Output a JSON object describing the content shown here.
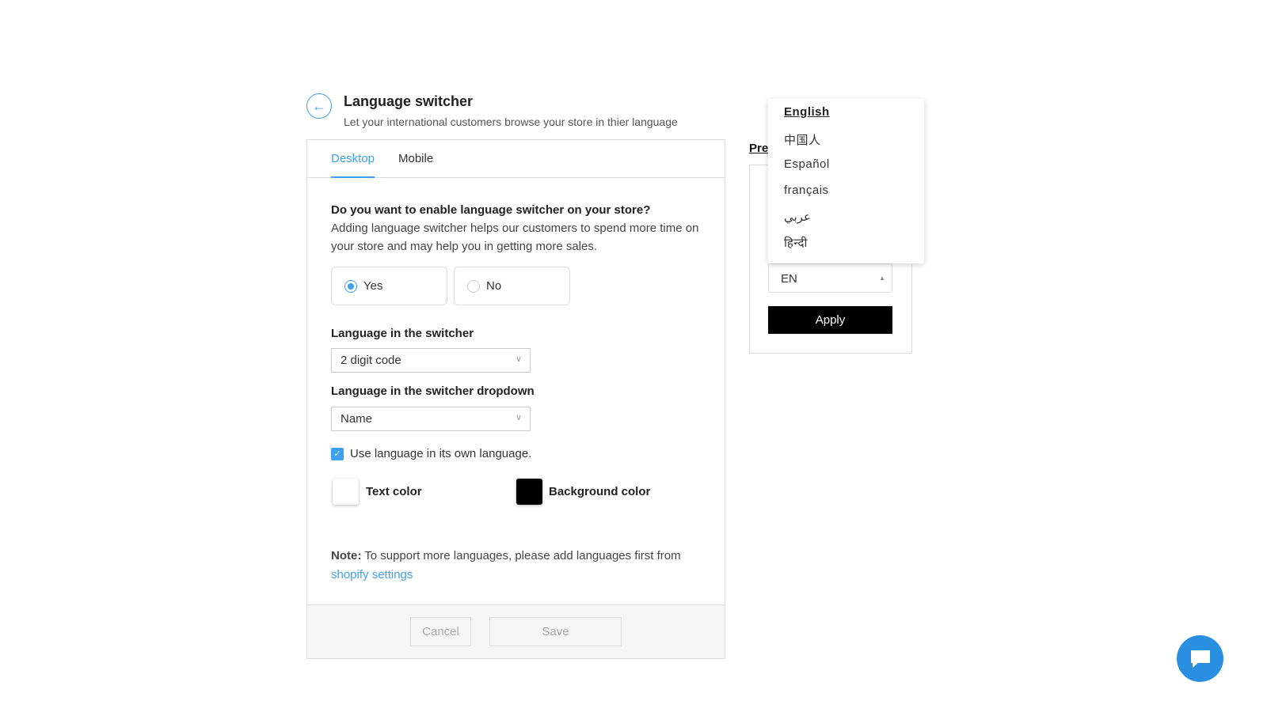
{
  "header": {
    "title": "Language switcher",
    "subtitle": "Let your international customers browse your store in thier language",
    "back_icon": "arrow-left-icon"
  },
  "tabs": [
    {
      "label": "Desktop",
      "active": true
    },
    {
      "label": "Mobile",
      "active": false
    }
  ],
  "enable": {
    "question": "Do you want to enable language switcher on your store?",
    "description": "Adding language switcher helps our customers to spend more time on your store and may help you in getting more sales.",
    "options": [
      {
        "label": "Yes",
        "selected": true
      },
      {
        "label": "No",
        "selected": false
      }
    ]
  },
  "switcher_language": {
    "label": "Language in the switcher",
    "value": "2 digit code"
  },
  "dropdown_language": {
    "label": "Language in the switcher dropdown",
    "value": "Name"
  },
  "own_language": {
    "label": "Use language in its own language.",
    "checked": true
  },
  "colors": {
    "text_label": "Text color",
    "text_value": "#ffffff",
    "bg_label": "Background color",
    "bg_value": "#000000",
    "accent": "#3ea0f0"
  },
  "note": {
    "prefix": "Note:",
    "text": " To support more languages, please add languages first from ",
    "link": "shopify settings"
  },
  "footer": {
    "cancel": "Cancel",
    "save": "Save"
  },
  "preview": {
    "label": "Preview",
    "select_value": "EN",
    "apply": "Apply",
    "options": [
      "English",
      "中国人",
      "Español",
      "français",
      "عربي",
      "हिन्दी"
    ],
    "selected_option": "English"
  }
}
